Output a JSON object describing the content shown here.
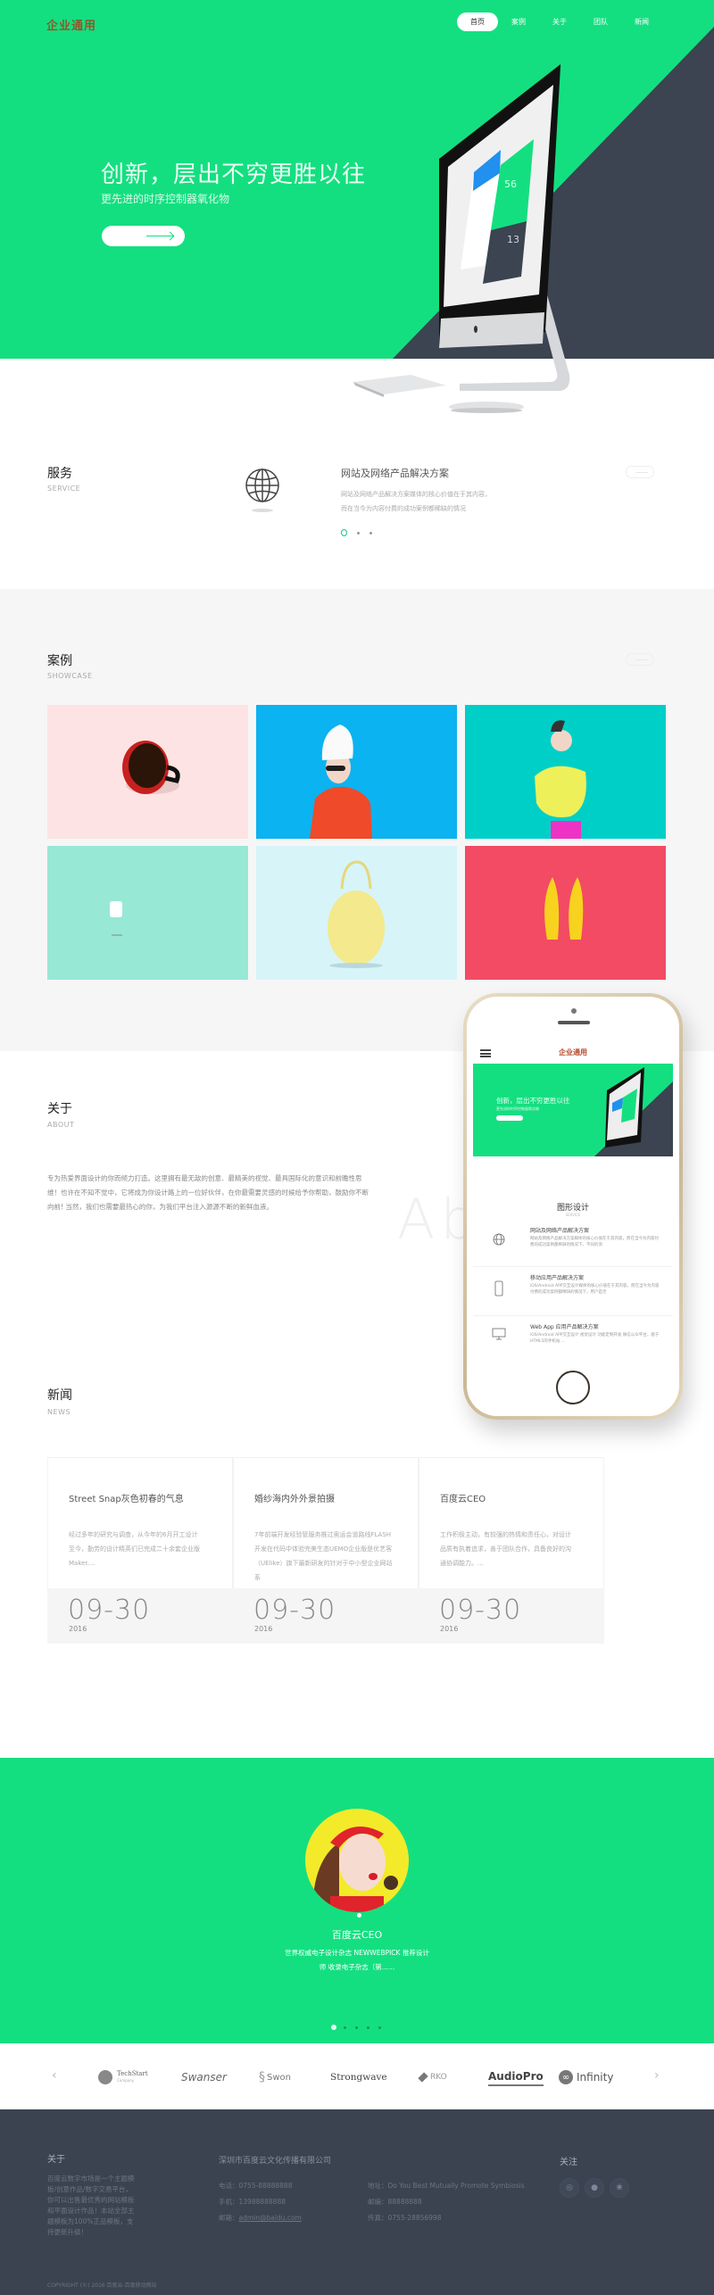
{
  "header": {
    "logo": "企业通用",
    "nav": [
      {
        "label": "首页",
        "active": true
      },
      {
        "label": "案例",
        "active": false
      },
      {
        "label": "关于",
        "active": false
      },
      {
        "label": "团队",
        "active": false
      },
      {
        "label": "新闻",
        "active": false
      }
    ]
  },
  "hero": {
    "title": "创新，层出不穷更胜以往",
    "subtitle": "更先进的时序控制器氧化物",
    "cta_icon": "arrow-right-icon",
    "screen_numbers": [
      "56",
      "13"
    ]
  },
  "service": {
    "title": "服务",
    "subtitle": "SERVICE",
    "item_icon": "globe-icon",
    "item_title": "网站及网络产品解决方案",
    "item_desc": "网站及网络产品解决方案媒体的核心价值在于其内容，而在当今为内容付费的成功案例都稀缺的情况",
    "slides": 3,
    "active_slide": 1
  },
  "showcase": {
    "title": "案例",
    "subtitle": "SHOWCASE",
    "items": [
      {
        "name": "coffee-cup",
        "bg": "#fde3e3"
      },
      {
        "name": "woman-towel-sunglasses",
        "bg": "#0bb3f0"
      },
      {
        "name": "woman-yellow-top",
        "bg": "#00cfc7"
      },
      {
        "name": "white-object",
        "bg": "#98e8d6"
      },
      {
        "name": "yellow-round-bag",
        "bg": "#d7f4f9"
      },
      {
        "name": "yellow-flats",
        "bg": "#f24b63"
      }
    ]
  },
  "about": {
    "title": "关于",
    "subtitle": "ABOUT",
    "text": "专为热爱界面设计的你而倾力打造。这里拥有最无敌的创意、最精美的视觉、最具国际化的意识和前瞻性思维！也许在不知不觉中，它将成为你设计路上的一位好伙伴，在你最需要灵感的时候给予你帮助，鼓励你不断向前! 当然，我们也需要最热心的你，为我们平台注入源源不断的新鲜血液。",
    "watermark": "About"
  },
  "phone": {
    "logo": "企业通用",
    "hero_title": "创新，层出不穷更胜以往",
    "hero_sub": "更先进的时序控制器氧化物",
    "section_title": "图形设计",
    "section_sub": "SERVICE",
    "items": [
      {
        "icon": "globe-icon",
        "title": "网站及网络产品解决方案",
        "desc": "网站及网络产品解决方案媒体的核心价值在于其内容，而在当今为内容付费的成功案例都稀缺的情况下，不同的浏"
      },
      {
        "icon": "mobile-icon",
        "title": "移动应用产品解决方案",
        "desc": "iOS/Android APP交互设计媒体的核心价值在于其内容，而在当今为内容付费的成功案例都稀缺的情况下，用户是否"
      },
      {
        "icon": "monitor-icon",
        "title": "Web App 应用产品解决方案",
        "desc": "iOS/Android APP交互设计 视觉设计 功能定制开发 微信公众平台，基于HTML5的手机站 ..."
      }
    ]
  },
  "news": {
    "title": "新闻",
    "subtitle": "NEWS",
    "items": [
      {
        "title": "Street Snap灰色初春的气息",
        "desc": "经过多年的研究与调查，从今年的6月开工设计至今，勤劳的设计精英们已完成二十余套企业版Maker....",
        "date": "09-30",
        "year": "2016"
      },
      {
        "title": "婚纱海内外外景拍摄",
        "desc": "7年前端开发经验管服务推过奥运会道路线FLASH开发在代码中体验完美生态UEMO企业版是优艺客（UElike）旗下最新研发的针对于中小型企业网站系",
        "date": "09-30",
        "year": "2016"
      },
      {
        "title": "百度云CEO",
        "desc": "工作积极主动，有较强的热情和责任心，对设计品质有执着追求，善于团队合作，具备良好的沟通协调能力。...",
        "date": "09-30",
        "year": "2016"
      }
    ]
  },
  "testimonial": {
    "name": "百度云CEO",
    "quote_line1": "世界权威电子设计杂志 NEWWEBPICK 推荐设计",
    "quote_line2": "师 收录电子杂志（第......",
    "slides": 5,
    "active_slide": 1
  },
  "partners": {
    "prev_icon": "chevron-left-icon",
    "next_icon": "chevron-right-icon",
    "logos": [
      "TechStart",
      "Swanser",
      "Swon",
      "Strongwave",
      "RKO",
      "AudioPro",
      "Infinity"
    ],
    "techstart_sub": "Company"
  },
  "footer": {
    "about_title": "关于",
    "about_text": "百度云数字市场是一个主题模板/创意作品/数字交易平台，你可以出售最优秀的网站模板和平面设计作品！本站全部主题模板为100%正品模板，支持更新升级！",
    "company": "深圳市百度云文化传播有限公司",
    "phone": "电话：0755-88888888",
    "mobile": "手机：13988888888",
    "email_label": "邮箱：",
    "email": "admin@baidu.com",
    "address": "地址：Do You Best Mutually Promote Symbiosis",
    "postcode": "邮编：88888888",
    "fax": "传真：0755-28856998",
    "follow_title": "关注",
    "social": [
      "weibo-icon",
      "qq-icon",
      "wechat-icon"
    ],
    "copyright": "COPYRIGHT (©) 2016 百度云-百度移动网站"
  },
  "colors": {
    "brand": "#14df80",
    "dark": "#3b4350",
    "logo": "#8b5a2b"
  }
}
